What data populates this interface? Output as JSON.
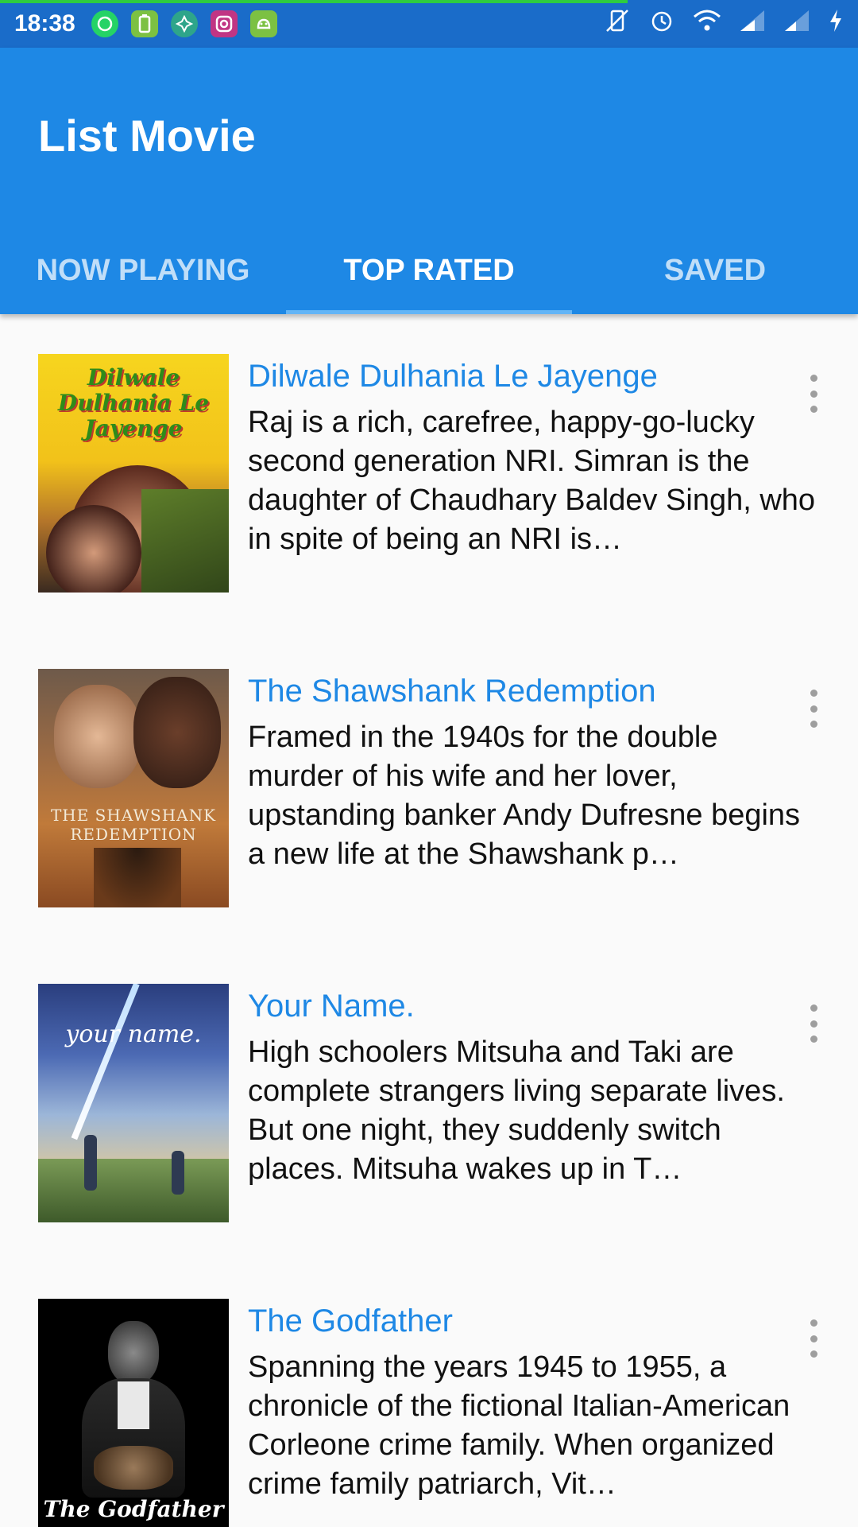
{
  "status_bar": {
    "time": "18:38",
    "notifications": [
      {
        "icon": "whatsapp-icon",
        "color": "#25d366"
      },
      {
        "icon": "battery-app-icon",
        "color": "#7cc142"
      },
      {
        "icon": "quran-app-icon",
        "color": "#2ea58a"
      },
      {
        "icon": "instagram-icon",
        "color": "#c13584"
      },
      {
        "icon": "android-icon",
        "color": "#7cc142"
      }
    ],
    "system_icons": [
      "vibrate-icon",
      "alarm-icon",
      "wifi-icon",
      "signal-icon",
      "signal-icon",
      "charging-icon"
    ]
  },
  "app_bar": {
    "title": "List Movie"
  },
  "tabs": [
    {
      "label": "NOW PLAYING",
      "active": false
    },
    {
      "label": "TOP RATED",
      "active": true
    },
    {
      "label": "SAVED",
      "active": false
    }
  ],
  "movies": [
    {
      "title": "Dilwale Dulhania Le Jayenge",
      "overview": "Raj is a rich, carefree, happy-go-lucky second generation NRI. Simran is the daughter of Chaudhary Baldev Singh, who in spite of being an NRI is…",
      "poster_lettering": "Dilwale Dulhania Le Jayenge"
    },
    {
      "title": "The Shawshank Redemption",
      "overview": "Framed in the 1940s for the double murder of his wife and her lover, upstanding banker Andy Dufresne begins a new life at the Shawshank p…",
      "poster_lettering": "THE SHAWSHANK REDEMPTION"
    },
    {
      "title": "Your Name.",
      "overview": "High schoolers Mitsuha and Taki are complete strangers living separate lives. But one night, they suddenly switch places. Mitsuha wakes up in T…",
      "poster_lettering": "your name."
    },
    {
      "title": "The Godfather",
      "overview": "Spanning the years 1945 to 1955, a chronicle of the fictional Italian-American Corleone crime family. When organized crime family patriarch, Vit…",
      "poster_lettering": "The Godfather"
    }
  ],
  "colors": {
    "status_bar": "#1a6cc9",
    "app_bar": "#1e88e5",
    "tab_indicator": "#64b5f6",
    "title_text": "#1e88e5"
  }
}
